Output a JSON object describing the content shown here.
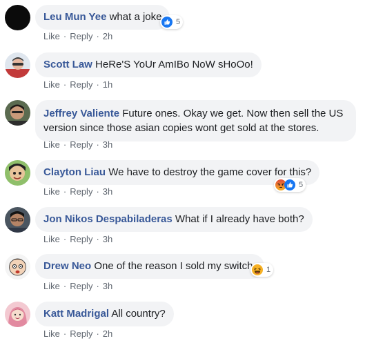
{
  "colors": {
    "author": "#385898",
    "bubble_bg": "#f2f3f5",
    "action_text": "#606770",
    "like_blue": "#1877f2",
    "angry": "#e9710f",
    "haha": "#f7b125"
  },
  "comments": [
    {
      "author": "Leu Mun Yee",
      "text": "what a joke",
      "like": "Like",
      "reply": "Reply",
      "time": "2h",
      "reaction_icons": [
        "like-icon"
      ],
      "reaction_count": "5"
    },
    {
      "author": "Scott Law",
      "text": "HeRe'S YoUr AmIBo NoW sHoOo!",
      "like": "Like",
      "reply": "Reply",
      "time": "1h"
    },
    {
      "author": "Jeffrey Valiente",
      "text": "Future ones. Okay we get. Now then sell the US version since those asian copies wont get sold at the stores.",
      "like": "Like",
      "reply": "Reply",
      "time": "3h"
    },
    {
      "author": "Clayton Liau",
      "text": "We have to destroy the game cover for this?",
      "like": "Like",
      "reply": "Reply",
      "time": "3h",
      "reaction_icons": [
        "angry-icon",
        "like-icon"
      ],
      "reaction_count": "5"
    },
    {
      "author": "Jon Nikos Despabiladeras",
      "text": "What if I already have both?",
      "like": "Like",
      "reply": "Reply",
      "time": "3h"
    },
    {
      "author": "Drew Neo",
      "text": "One of the reason I sold my switch.",
      "like": "Like",
      "reply": "Reply",
      "time": "3h",
      "reaction_icons": [
        "haha-icon"
      ],
      "reaction_count": "1"
    },
    {
      "author": "Katt Madrigal",
      "text": "All country?",
      "like": "Like",
      "reply": "Reply",
      "time": "2h"
    }
  ]
}
